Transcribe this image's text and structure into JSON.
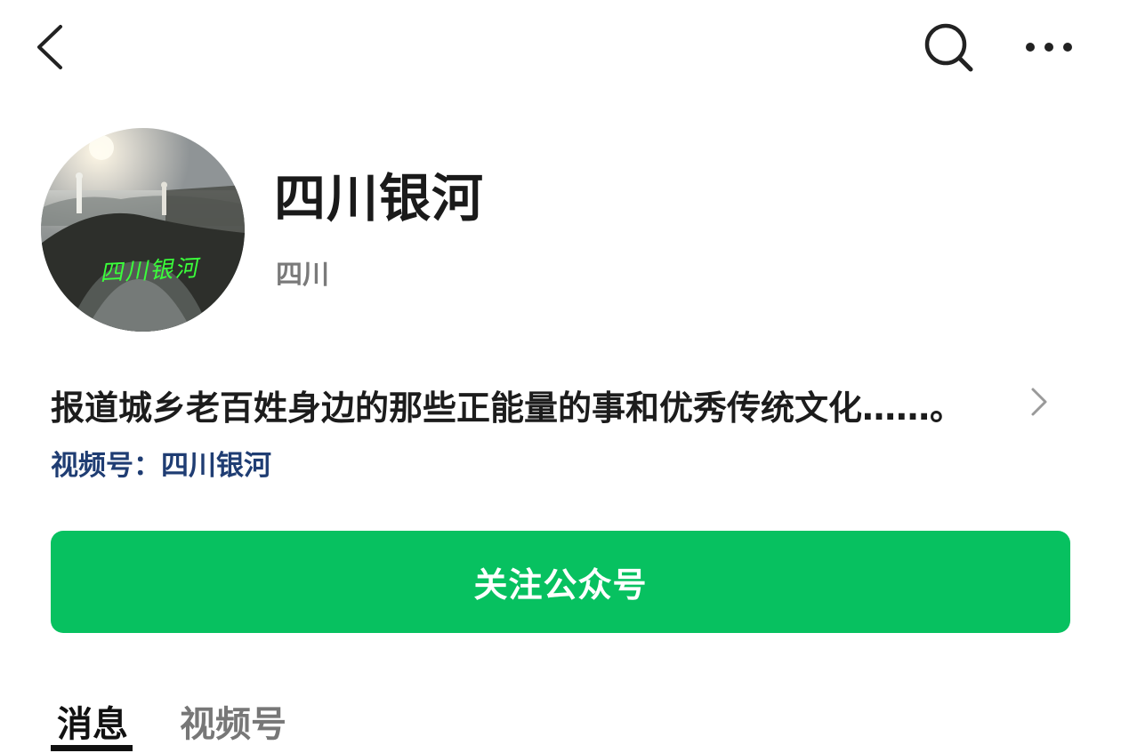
{
  "topbar": {
    "back_icon": "chevron-left-icon",
    "search_icon": "search-icon",
    "more_icon": "more-horizontal-icon"
  },
  "profile": {
    "avatar_text": "四川银河",
    "name": "四川银河",
    "region": "四川",
    "description": "报道城乡老百姓身边的那些正能量的事和优秀传统文化……。",
    "channel_link": "视频号：四川银河"
  },
  "follow_button": {
    "label": "关注公众号",
    "color": "#07c160"
  },
  "tabs": [
    {
      "label": "消息",
      "active": true
    },
    {
      "label": "视频号",
      "active": false
    }
  ],
  "colors": {
    "link": "#1f3d73",
    "secondary_text": "#7a7a7a"
  }
}
